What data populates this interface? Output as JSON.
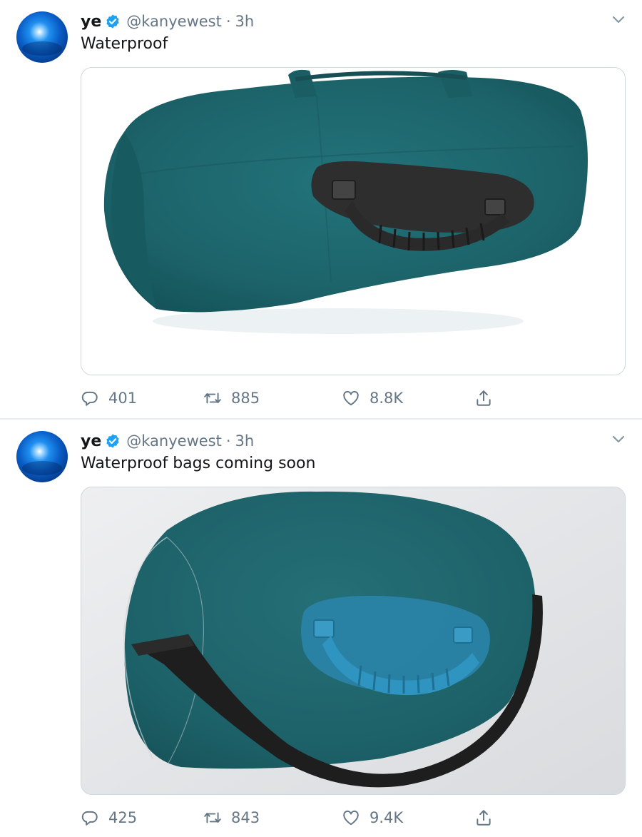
{
  "tweets": [
    {
      "author": {
        "name": "ye",
        "handle": "@kanyewest",
        "separator": "·",
        "time": "3h",
        "verified": true,
        "avatar": "blue-sphere-avatar"
      },
      "text": "Waterproof",
      "media": {
        "description_icon": "teal-duffel-bag-with-black-handle",
        "bag_color": "#1f6b72",
        "handle_color": "#2e2e2e"
      },
      "stats": {
        "replies": "401",
        "retweets": "885",
        "likes": "8.8K"
      }
    },
    {
      "author": {
        "name": "ye",
        "handle": "@kanyewest",
        "separator": "·",
        "time": "3h",
        "verified": true,
        "avatar": "blue-sphere-avatar"
      },
      "text": "Waterproof bags coming soon",
      "media": {
        "description_icon": "teal-bag-with-blue-handle-and-black-strap",
        "bag_color": "#1f6b72",
        "handle_color": "#2a8fb8",
        "strap_color": "#1e1e1e"
      },
      "stats": {
        "replies": "425",
        "retweets": "843",
        "likes": "9.4K"
      }
    }
  ],
  "colors": {
    "verified_badge": "#1da1f2",
    "secondary_text": "#657786",
    "divider": "#e6ecf0"
  },
  "icons": {
    "reply": "reply-icon",
    "retweet": "retweet-icon",
    "like": "heart-icon",
    "share": "share-icon",
    "more": "chevron-down-icon",
    "verified": "verified-badge-icon"
  }
}
